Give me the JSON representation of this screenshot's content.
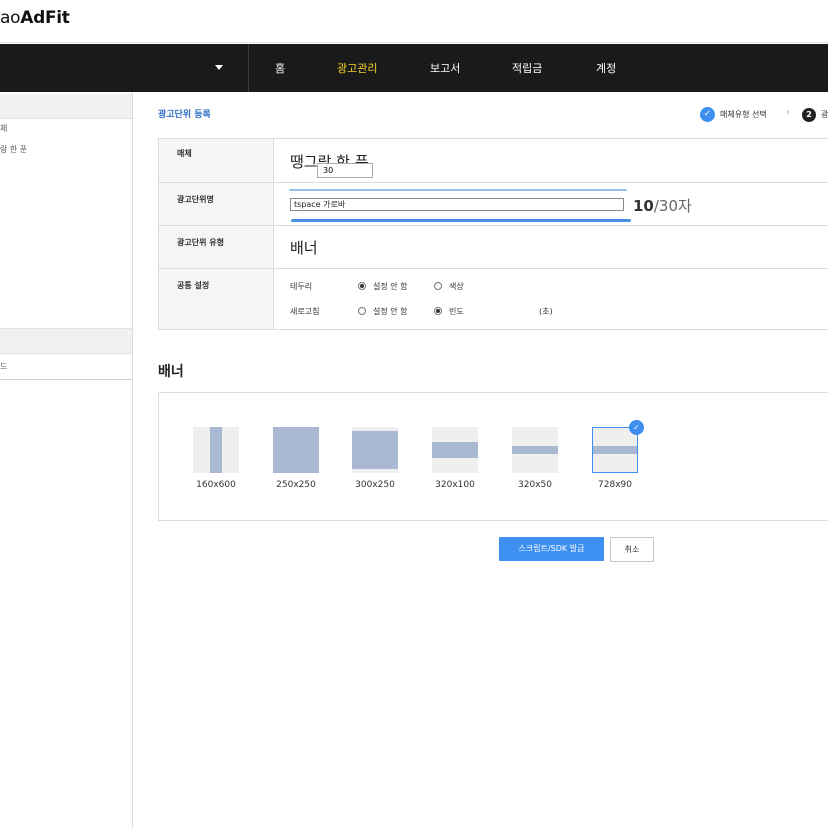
{
  "header": {
    "logo_prefix": "ao",
    "logo_main": "AdFit"
  },
  "nav": {
    "items": [
      {
        "label": "홈",
        "active": false
      },
      {
        "label": "광고관리",
        "active": true
      },
      {
        "label": "보고서",
        "active": false
      },
      {
        "label": "적립금",
        "active": false
      },
      {
        "label": "계정",
        "active": false
      }
    ]
  },
  "sidebar": {
    "items": [
      "체",
      "랑 한 푼"
    ],
    "section2_item": "드"
  },
  "page": {
    "title": "광고단위 등록"
  },
  "steps": {
    "step1": {
      "label": "매체유형 선택",
      "icon": "check-icon"
    },
    "step2": {
      "number": "2",
      "label": "광"
    }
  },
  "form": {
    "media_label": "매체",
    "media_value": "땡그랑 한 푼",
    "name_label": "광고단위명",
    "name_value": "tspace 가로바",
    "char_count_current": "10",
    "char_count_max": "/30자",
    "type_label": "광고단위 유형",
    "type_value": "배너",
    "common_label": "공통 설정",
    "border_label": "테두리",
    "border_option_none": "설정 안 함",
    "border_option_color": "색상",
    "refresh_label": "새로고침",
    "refresh_option_none": "설정 안 함",
    "refresh_option_freq": "빈도",
    "refresh_freq_value": "30",
    "refresh_unit": "(초)"
  },
  "banner": {
    "section_title": "배너",
    "sizes": [
      "160x600",
      "250x250",
      "300x250",
      "320x100",
      "320x50",
      "728x90"
    ],
    "selected": "728x90"
  },
  "actions": {
    "issue_label": "스크립트/SDK 발급",
    "cancel_label": "취소"
  },
  "colors": {
    "nav_bg": "#1a1a1a",
    "nav_active": "#f7d628",
    "accent": "#3d8ff0",
    "title_blue": "#2e6bc7"
  }
}
